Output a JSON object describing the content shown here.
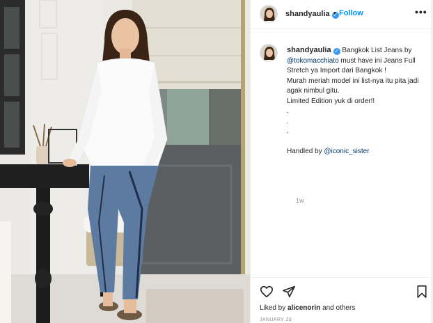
{
  "header": {
    "username": "shandyaulia",
    "verified_glyph": "✓",
    "separator": "•",
    "follow_label": "Follow",
    "more_glyph": "•••"
  },
  "caption": {
    "username": "shandyaulia",
    "lines": [
      "Bangkok List Jeans by",
      "@tokomacchiato",
      "must have ini Jeans Full Stretch ya Import dari Bangkok !",
      "Murah meriah model ini list-nya itu pita jadi agak nimbul gitu.",
      "Limited Edition yuk di order!!",
      ".",
      ".",
      ".",
      "Handled by",
      "@iconic_sister"
    ],
    "time_ago": "1w"
  },
  "actions": {
    "icons": [
      "heart-icon",
      "share-icon",
      "bookmark-icon"
    ],
    "liked_by_prefix": "Liked by",
    "liked_by_user": "alicenorin",
    "liked_by_suffix": "and others",
    "date": "JANUARY 28"
  },
  "colors": {
    "link": "#0095f6",
    "mention": "#00376b",
    "muted": "#8e8e8e",
    "verified": "#3897f0"
  }
}
